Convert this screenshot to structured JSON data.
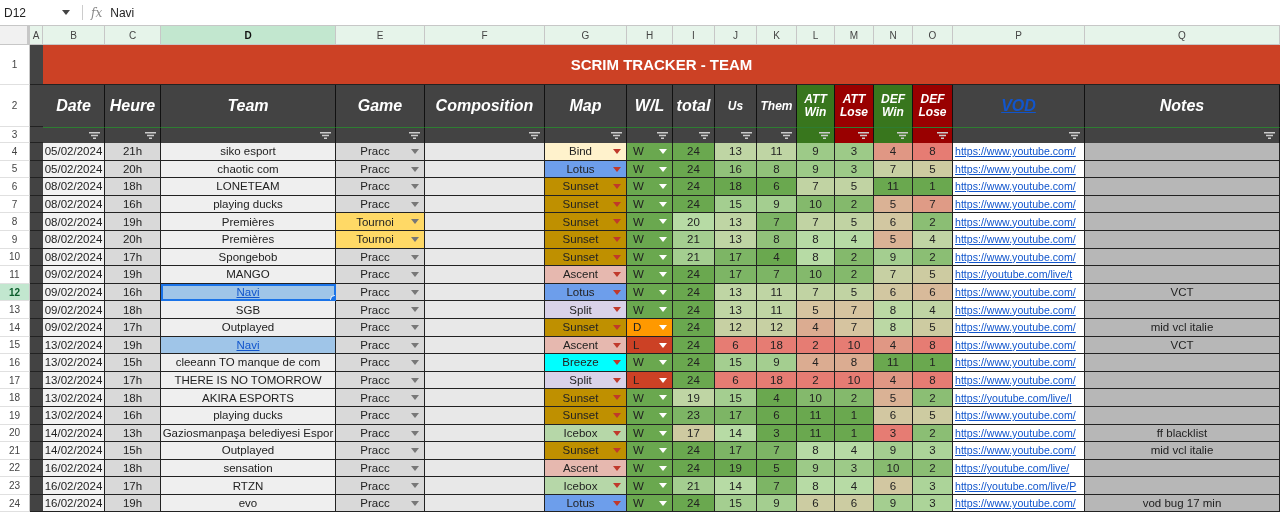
{
  "formula_bar": {
    "cell_ref": "D12",
    "icon": "fx",
    "value": "Navi"
  },
  "columns": [
    {
      "label": "A",
      "selected": false
    },
    {
      "label": "B",
      "selected": false
    },
    {
      "label": "C",
      "selected": false
    },
    {
      "label": "D",
      "selected": true
    },
    {
      "label": "E",
      "selected": false
    },
    {
      "label": "F",
      "selected": false
    },
    {
      "label": "G",
      "selected": false
    },
    {
      "label": "H",
      "selected": false
    },
    {
      "label": "I",
      "selected": false
    },
    {
      "label": "J",
      "selected": false
    },
    {
      "label": "K",
      "selected": false
    },
    {
      "label": "L",
      "selected": false
    },
    {
      "label": "M",
      "selected": false
    },
    {
      "label": "N",
      "selected": false
    },
    {
      "label": "O",
      "selected": false
    },
    {
      "label": "P",
      "selected": false
    },
    {
      "label": "Q",
      "selected": false
    }
  ],
  "header_rows": [
    "1",
    "2",
    "3"
  ],
  "title": "SCRIM TRACKER - TEAM",
  "headers": [
    {
      "label": "Date",
      "color": "#434343"
    },
    {
      "label": "Heure",
      "color": "#434343"
    },
    {
      "label": "Team",
      "color": "#434343"
    },
    {
      "label": "Game",
      "color": "#434343"
    },
    {
      "label": "Composition",
      "color": "#434343"
    },
    {
      "label": "Map",
      "color": "#434343"
    },
    {
      "label": "W/L",
      "color": "#434343"
    },
    {
      "label": "total",
      "color": "#434343"
    },
    {
      "label": "Us",
      "color": "#434343",
      "kind": "small"
    },
    {
      "label": "Them",
      "color": "#434343",
      "kind": "small"
    },
    {
      "label": "ATT Win",
      "color": "#38761d",
      "kind": "small"
    },
    {
      "label": "ATT Lose",
      "color": "#990000",
      "kind": "small"
    },
    {
      "label": "DEF Win",
      "color": "#38761d",
      "kind": "small"
    },
    {
      "label": "DEF Lose",
      "color": "#990000",
      "kind": "small"
    },
    {
      "label": "VOD",
      "color": "#434343",
      "kind": "link"
    },
    {
      "label": "Notes",
      "color": "#434343"
    }
  ],
  "rows": [
    {
      "row": "4",
      "selected": false,
      "date": "05/02/2024",
      "time": "21h",
      "team": {
        "text": "siko esport",
        "link": false,
        "selected": false
      },
      "game": {
        "label": "Pracc",
        "color": "#d9d9d9"
      },
      "map": {
        "label": "Bind",
        "color": "#fff2cc"
      },
      "result": {
        "label": "W",
        "color": "#6aa84f"
      },
      "total": "24",
      "us": "13",
      "them": "11",
      "att_win": "9",
      "att_lose": "3",
      "def_win": "4",
      "def_lose": "8",
      "vod": "https://www.youtube.com/"
    },
    {
      "row": "5",
      "selected": false,
      "date": "05/02/2024",
      "time": "20h",
      "team": {
        "text": "chaotic com",
        "link": false,
        "selected": false
      },
      "game": {
        "label": "Pracc",
        "color": "#d9d9d9"
      },
      "map": {
        "label": "Lotus",
        "color": "#6d9eeb"
      },
      "result": {
        "label": "W",
        "color": "#6aa84f"
      },
      "total": "24",
      "us": "16",
      "them": "8",
      "att_win": "9",
      "att_lose": "3",
      "def_win": "7",
      "def_lose": "5",
      "vod": "https://www.youtube.com/"
    },
    {
      "row": "6",
      "selected": false,
      "date": "08/02/2024",
      "time": "18h",
      "team": {
        "text": "LONETEAM",
        "link": false,
        "selected": false
      },
      "game": {
        "label": "Pracc",
        "color": "#d9d9d9"
      },
      "map": {
        "label": "Sunset",
        "color": "#bf9000"
      },
      "result": {
        "label": "W",
        "color": "#6aa84f"
      },
      "total": "24",
      "us": "18",
      "them": "6",
      "att_win": "7",
      "att_lose": "5",
      "def_win": "11",
      "def_lose": "1",
      "vod": "https://www.youtube.com/"
    },
    {
      "row": "7",
      "selected": false,
      "date": "08/02/2024",
      "time": "16h",
      "team": {
        "text": "playing ducks",
        "link": false,
        "selected": false
      },
      "game": {
        "label": "Pracc",
        "color": "#d9d9d9"
      },
      "map": {
        "label": "Sunset",
        "color": "#bf9000"
      },
      "result": {
        "label": "W",
        "color": "#6aa84f"
      },
      "total": "24",
      "us": "15",
      "them": "9",
      "att_win": "10",
      "att_lose": "2",
      "def_win": "5",
      "def_lose": "7",
      "vod": "https://www.youtube.com/"
    },
    {
      "row": "8",
      "selected": false,
      "date": "08/02/2024",
      "time": "19h",
      "team": {
        "text": "Premières",
        "link": false,
        "selected": false
      },
      "game": {
        "label": "Tournoi",
        "color": "#ffd966"
      },
      "map": {
        "label": "Sunset",
        "color": "#bf9000"
      },
      "result": {
        "label": "W",
        "color": "#6aa84f"
      },
      "total": "20",
      "us": "13",
      "them": "7",
      "att_win": "7",
      "att_lose": "5",
      "def_win": "6",
      "def_lose": "2",
      "vod": "https://www.youtube.com/"
    },
    {
      "row": "9",
      "selected": false,
      "date": "08/02/2024",
      "time": "20h",
      "team": {
        "text": "Premières",
        "link": false,
        "selected": false
      },
      "game": {
        "label": "Tournoi",
        "color": "#ffd966"
      },
      "map": {
        "label": "Sunset",
        "color": "#bf9000"
      },
      "result": {
        "label": "W",
        "color": "#6aa84f"
      },
      "total": "21",
      "us": "13",
      "them": "8",
      "att_win": "8",
      "att_lose": "4",
      "def_win": "5",
      "def_lose": "4",
      "vod": "https://www.youtube.com/"
    },
    {
      "row": "10",
      "selected": false,
      "date": "08/02/2024",
      "time": "17h",
      "team": {
        "text": "Spongebob",
        "link": false,
        "selected": false
      },
      "game": {
        "label": "Pracc",
        "color": "#d9d9d9"
      },
      "map": {
        "label": "Sunset",
        "color": "#bf9000"
      },
      "result": {
        "label": "W",
        "color": "#6aa84f"
      },
      "total": "21",
      "us": "17",
      "them": "4",
      "att_win": "8",
      "att_lose": "2",
      "def_win": "9",
      "def_lose": "2",
      "vod": "https://www.youtube.com/"
    },
    {
      "row": "11",
      "selected": false,
      "date": "09/02/2024",
      "time": "19h",
      "team": {
        "text": "MANGO",
        "link": false,
        "selected": false
      },
      "game": {
        "label": "Pracc",
        "color": "#d9d9d9"
      },
      "map": {
        "label": "Ascent",
        "color": "#e6b8af"
      },
      "result": {
        "label": "W",
        "color": "#6aa84f"
      },
      "total": "24",
      "us": "17",
      "them": "7",
      "att_win": "10",
      "att_lose": "2",
      "def_win": "7",
      "def_lose": "5",
      "vod": "https://youtube.com/live/t"
    },
    {
      "row": "12",
      "selected": true,
      "date": "09/02/2024",
      "time": "16h",
      "team": {
        "text": "Navi",
        "link": true,
        "selected": true
      },
      "game": {
        "label": "Pracc",
        "color": "#d9d9d9"
      },
      "map": {
        "label": "Lotus",
        "color": "#6d9eeb"
      },
      "result": {
        "label": "W",
        "color": "#6aa84f"
      },
      "total": "24",
      "us": "13",
      "them": "11",
      "att_win": "7",
      "att_lose": "5",
      "def_win": "6",
      "def_lose": "6",
      "vod": "https://www.youtube.com/",
      "notes": "VCT"
    },
    {
      "row": "13",
      "selected": false,
      "date": "09/02/2024",
      "time": "18h",
      "team": {
        "text": "SGB",
        "link": false,
        "selected": false
      },
      "game": {
        "label": "Pracc",
        "color": "#d9d9d9"
      },
      "map": {
        "label": "Split",
        "color": "#d9d2e9"
      },
      "result": {
        "label": "W",
        "color": "#6aa84f"
      },
      "total": "24",
      "us": "13",
      "them": "11",
      "att_win": "5",
      "att_lose": "7",
      "def_win": "8",
      "def_lose": "4",
      "vod": "https://www.youtube.com/"
    },
    {
      "row": "14",
      "selected": false,
      "date": "09/02/2024",
      "time": "17h",
      "team": {
        "text": "Outplayed",
        "link": false,
        "selected": false
      },
      "game": {
        "label": "Pracc",
        "color": "#d9d9d9"
      },
      "map": {
        "label": "Sunset",
        "color": "#bf9000"
      },
      "result": {
        "label": "D",
        "color": "#ff9900"
      },
      "total": "24",
      "us": "12",
      "them": "12",
      "att_win": "4",
      "att_lose": "7",
      "def_win": "8",
      "def_lose": "5",
      "vod": "https://www.youtube.com/",
      "notes": "mid vcl italie"
    },
    {
      "row": "15",
      "selected": false,
      "date": "13/02/2024",
      "time": "19h",
      "team": {
        "text": "Navi",
        "link": true,
        "selected": false
      },
      "game": {
        "label": "Pracc",
        "color": "#d9d9d9"
      },
      "map": {
        "label": "Ascent",
        "color": "#e6b8af"
      },
      "result": {
        "label": "L",
        "color": "#cc4125"
      },
      "total": "24",
      "us": "6",
      "them": "18",
      "att_win": "2",
      "att_lose": "10",
      "def_win": "4",
      "def_lose": "8",
      "vod": "https://www.youtube.com/",
      "notes": "VCT"
    },
    {
      "row": "16",
      "selected": false,
      "date": "13/02/2024",
      "time": "15h",
      "team": {
        "text": "cleeann TO manque de com",
        "link": false,
        "selected": false
      },
      "game": {
        "label": "Pracc",
        "color": "#d9d9d9"
      },
      "map": {
        "label": "Breeze",
        "color": "#00ffff"
      },
      "result": {
        "label": "W",
        "color": "#6aa84f"
      },
      "total": "24",
      "us": "15",
      "them": "9",
      "att_win": "4",
      "att_lose": "8",
      "def_win": "11",
      "def_lose": "1",
      "vod": "https://www.youtube.com/"
    },
    {
      "row": "17",
      "selected": false,
      "date": "13/02/2024",
      "time": "17h",
      "team": {
        "text": "THERE IS NO TOMORROW",
        "link": false,
        "selected": false
      },
      "game": {
        "label": "Pracc",
        "color": "#d9d9d9"
      },
      "map": {
        "label": "Split",
        "color": "#d9d2e9"
      },
      "result": {
        "label": "L",
        "color": "#cc4125"
      },
      "total": "24",
      "us": "6",
      "them": "18",
      "att_win": "2",
      "att_lose": "10",
      "def_win": "4",
      "def_lose": "8",
      "vod": "https://www.youtube.com/"
    },
    {
      "row": "18",
      "selected": false,
      "date": "13/02/2024",
      "time": "18h",
      "team": {
        "text": "AKIRA ESPORTS",
        "link": false,
        "selected": false
      },
      "game": {
        "label": "Pracc",
        "color": "#d9d9d9"
      },
      "map": {
        "label": "Sunset",
        "color": "#bf9000"
      },
      "result": {
        "label": "W",
        "color": "#6aa84f"
      },
      "total": "19",
      "us": "15",
      "them": "4",
      "att_win": "10",
      "att_lose": "2",
      "def_win": "5",
      "def_lose": "2",
      "vod": "https://youtube.com/live/l"
    },
    {
      "row": "19",
      "selected": false,
      "date": "13/02/2024",
      "time": "16h",
      "team": {
        "text": "playing ducks",
        "link": false,
        "selected": false
      },
      "game": {
        "label": "Pracc",
        "color": "#d9d9d9"
      },
      "map": {
        "label": "Sunset",
        "color": "#bf9000"
      },
      "result": {
        "label": "W",
        "color": "#6aa84f"
      },
      "total": "23",
      "us": "17",
      "them": "6",
      "att_win": "11",
      "att_lose": "1",
      "def_win": "6",
      "def_lose": "5",
      "vod": "https://www.youtube.com/"
    },
    {
      "row": "20",
      "selected": false,
      "date": "14/02/2024",
      "time": "13h",
      "team": {
        "text": "Gaziosmanpaşa belediyesi Espor",
        "link": false,
        "selected": false
      },
      "game": {
        "label": "Pracc",
        "color": "#d9d9d9"
      },
      "map": {
        "label": "Icebox",
        "color": "#b6d7a8"
      },
      "result": {
        "label": "W",
        "color": "#6aa84f"
      },
      "total": "17",
      "us": "14",
      "them": "3",
      "att_win": "11",
      "att_lose": "1",
      "def_win": "3",
      "def_lose": "2",
      "vod": "https://www.youtube.com/",
      "notes": "ff blacklist"
    },
    {
      "row": "21",
      "selected": false,
      "date": "14/02/2024",
      "time": "15h",
      "team": {
        "text": "Outplayed",
        "link": false,
        "selected": false
      },
      "game": {
        "label": "Pracc",
        "color": "#d9d9d9"
      },
      "map": {
        "label": "Sunset",
        "color": "#bf9000"
      },
      "result": {
        "label": "W",
        "color": "#6aa84f"
      },
      "total": "24",
      "us": "17",
      "them": "7",
      "att_win": "8",
      "att_lose": "4",
      "def_win": "9",
      "def_lose": "3",
      "vod": "https://www.youtube.com/",
      "notes": "mid vcl italie"
    },
    {
      "row": "22",
      "selected": false,
      "date": "16/02/2024",
      "time": "18h",
      "team": {
        "text": "sensation",
        "link": false,
        "selected": false
      },
      "game": {
        "label": "Pracc",
        "color": "#d9d9d9"
      },
      "map": {
        "label": "Ascent",
        "color": "#e6b8af"
      },
      "result": {
        "label": "W",
        "color": "#6aa84f"
      },
      "total": "24",
      "us": "19",
      "them": "5",
      "att_win": "9",
      "att_lose": "3",
      "def_win": "10",
      "def_lose": "2",
      "vod": "https://youtube.com/live/"
    },
    {
      "row": "23",
      "selected": false,
      "date": "16/02/2024",
      "time": "17h",
      "team": {
        "text": "RTZN",
        "link": false,
        "selected": false
      },
      "game": {
        "label": "Pracc",
        "color": "#d9d9d9"
      },
      "map": {
        "label": "Icebox",
        "color": "#b6d7a8"
      },
      "result": {
        "label": "W",
        "color": "#6aa84f"
      },
      "total": "21",
      "us": "14",
      "them": "7",
      "att_win": "8",
      "att_lose": "4",
      "def_win": "6",
      "def_lose": "3",
      "vod": "https://youtube.com/live/P"
    },
    {
      "row": "24",
      "selected": false,
      "date": "16/02/2024",
      "time": "19h",
      "team": {
        "text": "evo",
        "link": false,
        "selected": false
      },
      "game": {
        "label": "Pracc",
        "color": "#d9d9d9"
      },
      "map": {
        "label": "Lotus",
        "color": "#6d9eeb"
      },
      "result": {
        "label": "W",
        "color": "#6aa84f"
      },
      "total": "24",
      "us": "15",
      "them": "9",
      "att_win": "6",
      "att_lose": "6",
      "def_win": "9",
      "def_lose": "3",
      "vod": "https://www.youtube.com/",
      "notes": "vod bug 17 min"
    }
  ]
}
